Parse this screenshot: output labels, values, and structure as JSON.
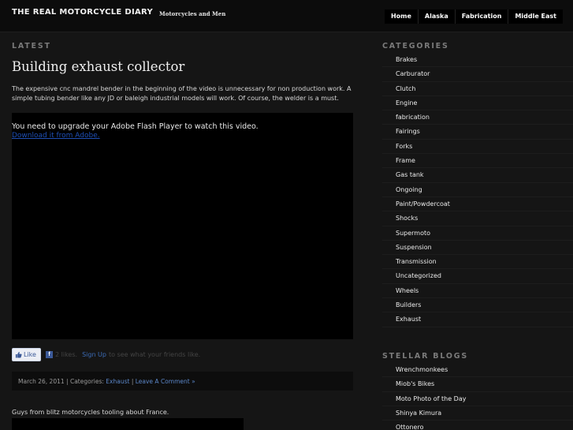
{
  "header": {
    "title": "THE REAL MOTORCYCLE DIARY",
    "tagline": "Motorcycles and Men",
    "nav": [
      "Home",
      "Alaska",
      "Fabrication",
      "Middle East"
    ]
  },
  "main": {
    "section_label": "LATEST",
    "post": {
      "title": "Building exhaust collector",
      "excerpt": "The expensive cnc mandrel bender in the beginning of the video is unnecessary for non production work. A simple tubing bender like any JD or baleigh industrial models will work. Of course, the welder is a must.",
      "flash_message": "You need to upgrade your Adobe Flash Player to watch this video.",
      "flash_link": "Download it from Adobe."
    },
    "like": {
      "button_label": "Like",
      "fb_glyph": "f",
      "count": "2 likes.",
      "signup": "Sign Up",
      "suffix": "to see what your friends like."
    },
    "meta": {
      "date": "March 26, 2011",
      "separator": " | ",
      "categories_prefix": "Categories: ",
      "category": "Exhaust",
      "comment_link": "Leave A Comment »"
    },
    "post2_excerpt": "Guys from blitz motorcycles tooling about France."
  },
  "sidebar": {
    "categories_label": "CATEGORIES",
    "categories": [
      "Brakes",
      "Carburator",
      "Clutch",
      "Engine",
      "fabrication",
      "Fairings",
      "Forks",
      "Frame",
      "Gas tank",
      "Ongoing",
      "Paint/Powdercoat",
      "Shocks",
      "Supermoto",
      "Suspension",
      "Transmission",
      "Uncategorized",
      "Wheels",
      "Builders",
      "Exhaust"
    ],
    "stellar_label": "STELLAR BLOGS",
    "stellar_blogs": [
      "Wrenchmonkees",
      "Miob's Bikes",
      "Moto Photo of the Day",
      "Shinya Kimura",
      "Ottonero"
    ]
  }
}
